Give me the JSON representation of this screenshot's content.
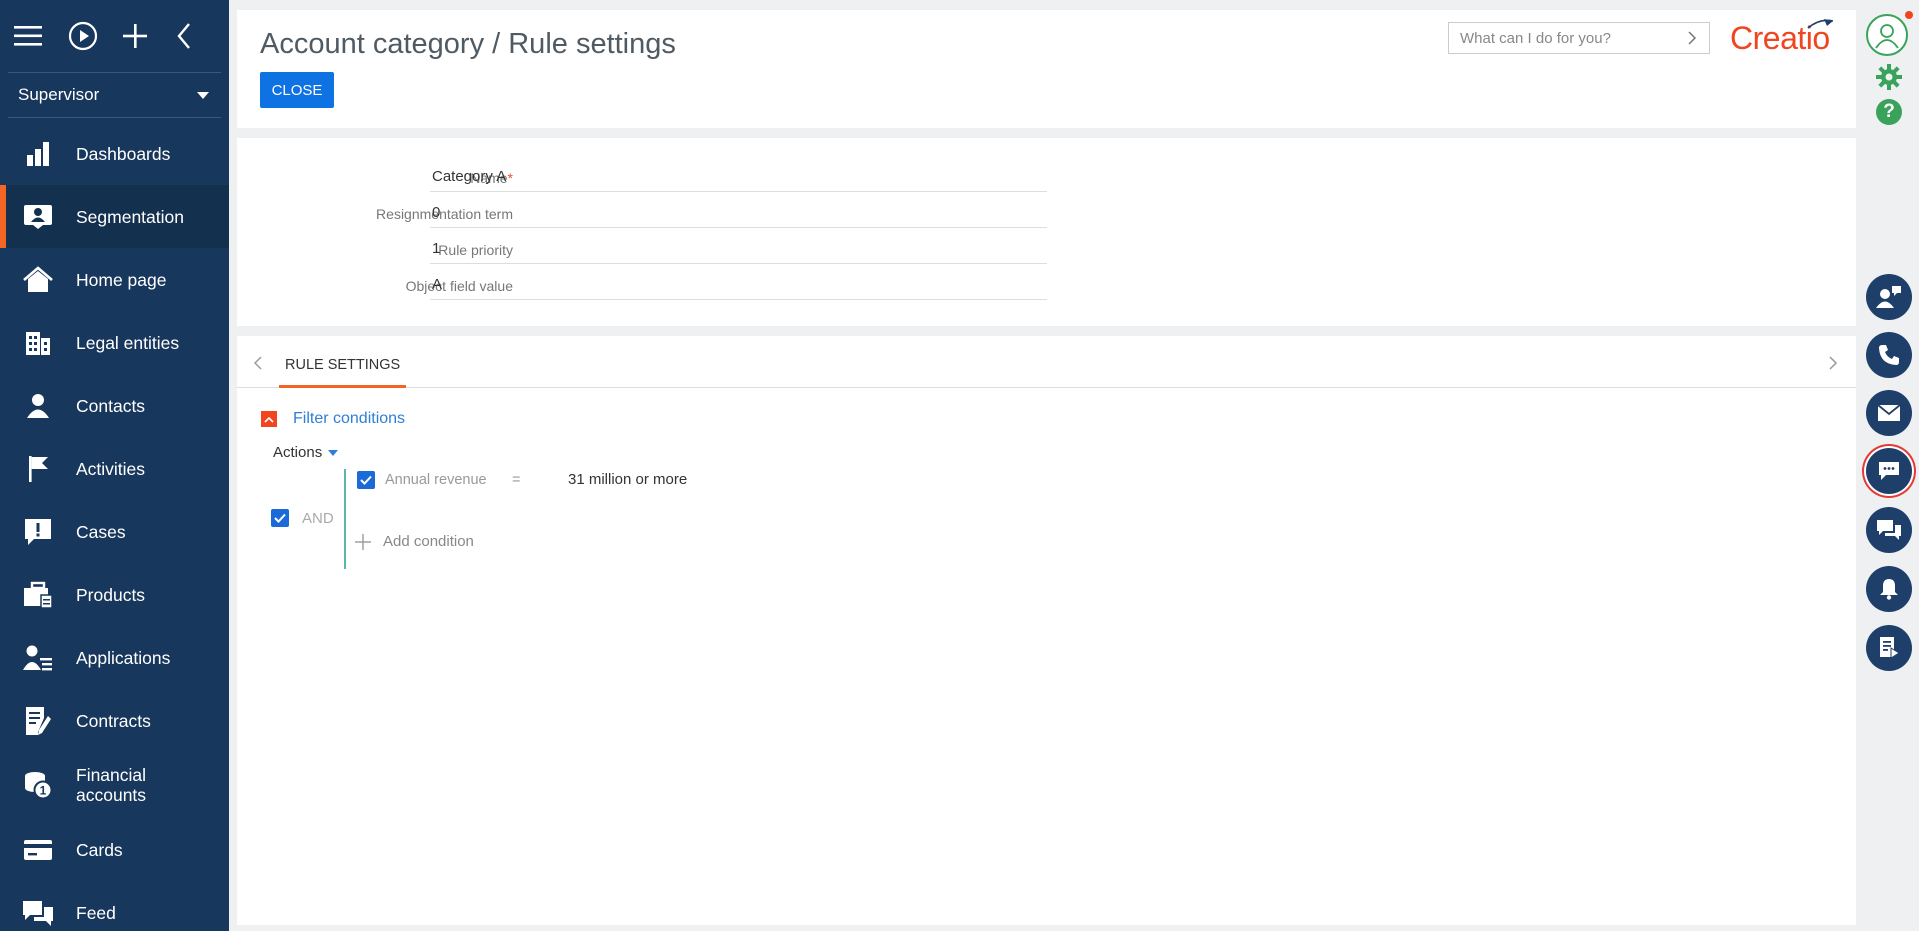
{
  "app": {
    "role": "Supervisor",
    "logo": "Creatio"
  },
  "sidebar": {
    "items": [
      {
        "label": "Dashboards"
      },
      {
        "label": "Segmentation",
        "active": true
      },
      {
        "label": "Home page"
      },
      {
        "label": "Legal entities"
      },
      {
        "label": "Contacts"
      },
      {
        "label": "Activities"
      },
      {
        "label": "Cases"
      },
      {
        "label": "Products"
      },
      {
        "label": "Applications"
      },
      {
        "label": "Contracts"
      },
      {
        "label": "Financial accounts"
      },
      {
        "label": "Cards"
      },
      {
        "label": "Feed"
      }
    ]
  },
  "header": {
    "title": "Account category / Rule settings",
    "close_label": "CLOSE",
    "search_placeholder": "What can I do for you?"
  },
  "fields": [
    {
      "label": "Name",
      "required": "*",
      "value": "Category A"
    },
    {
      "label": "Resignmentation term",
      "value": "0"
    },
    {
      "label": "Rule priority",
      "value": "1"
    },
    {
      "label": "Object field value",
      "value": "A"
    }
  ],
  "rules": {
    "tab_label": "RULE SETTINGS",
    "filter_title": "Filter conditions",
    "actions_label": "Actions",
    "group_operator": "AND",
    "condition": {
      "field": "Annual revenue",
      "operator": "=",
      "value": "31 million or more"
    },
    "add_condition_label": "Add condition"
  },
  "colors": {
    "sidebar_bg": "#18375c",
    "accent": "#f26522",
    "primary_button": "#0e72e3",
    "logo": "#f0451e",
    "status_green": "#3aa35b",
    "right_button": "#1f3f6b"
  },
  "icons": {
    "right_panel": [
      "contact-feedback-icon",
      "phone-icon",
      "email-icon",
      "chat-icon",
      "messages-icon",
      "bell-icon",
      "document-play-icon"
    ]
  }
}
